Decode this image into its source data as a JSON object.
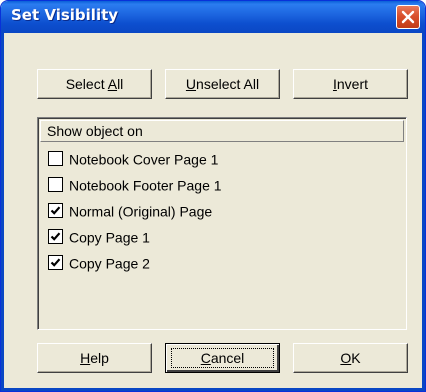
{
  "window": {
    "title": "Set Visibility"
  },
  "toolbar": {
    "select_all": {
      "pre": "Select ",
      "mnemonic": "A",
      "post": "ll"
    },
    "unselect_all": {
      "pre": "",
      "mnemonic": "U",
      "post": "nselect All"
    },
    "invert": {
      "pre": "",
      "mnemonic": "I",
      "post": "nvert"
    }
  },
  "list": {
    "header": "Show object on",
    "items": [
      {
        "label": "Notebook Cover Page 1",
        "checked": false
      },
      {
        "label": "Notebook Footer Page 1",
        "checked": false
      },
      {
        "label": "Normal (Original) Page",
        "checked": true
      },
      {
        "label": "Copy Page 1",
        "checked": true
      },
      {
        "label": "Copy Page 2",
        "checked": true
      }
    ]
  },
  "footer": {
    "help": {
      "pre": "",
      "mnemonic": "H",
      "post": "elp"
    },
    "cancel": {
      "pre": "",
      "mnemonic": "C",
      "post": "ancel"
    },
    "ok": {
      "pre": "",
      "mnemonic": "O",
      "post": "K"
    }
  },
  "colors": {
    "titlebar": "#0a5fd8",
    "dialog_face": "#ece9d8",
    "close_button": "#d9502d"
  },
  "icons": {
    "close": "close-icon",
    "check": "checkmark-icon"
  }
}
